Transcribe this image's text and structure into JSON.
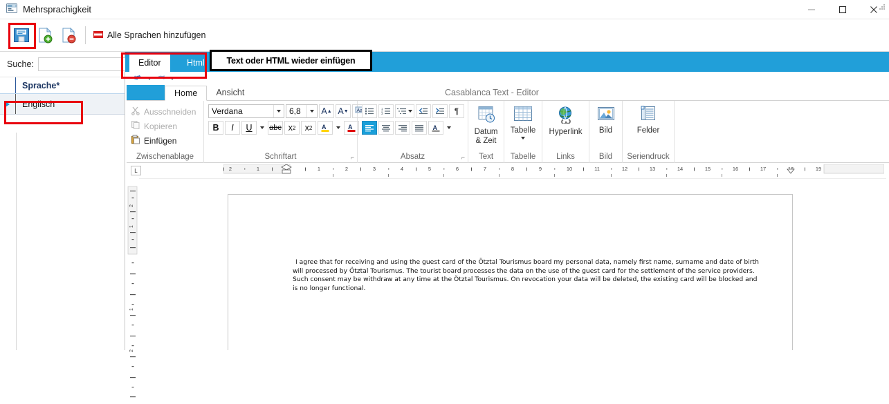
{
  "window": {
    "title": "Mehrsprachigkeit",
    "app_icon": "multilanguage-icon",
    "controls": {
      "minimize": "minimize-icon",
      "maximize": "maximize-icon",
      "close": "close-icon"
    }
  },
  "toolbar": {
    "save_label": "Speichern",
    "add_label": "Hinzufügen",
    "remove_label": "Entfernen",
    "add_all_languages_label": "Alle Sprachen hinzufügen"
  },
  "sidebar": {
    "search": {
      "label": "Suche:",
      "value": "",
      "placeholder": "",
      "clear_label": "×"
    },
    "grid": {
      "columns": [
        "Sprache*"
      ],
      "rows": [
        {
          "indicator": "▶",
          "language": "Englisch"
        }
      ]
    }
  },
  "callout": {
    "text": "Text oder HTML wieder einfügen"
  },
  "editor": {
    "tabs": [
      {
        "label": "Editor",
        "selected": true
      },
      {
        "label": "Html",
        "selected": false
      }
    ],
    "window_title": "Casablanca Text - Editor",
    "quick_access": [
      "undo-icon",
      "redo-icon",
      "customize-icon"
    ],
    "ribbon_tabs": [
      {
        "label": "Home",
        "selected": true
      },
      {
        "label": "Ansicht",
        "selected": false
      }
    ],
    "ribbon_groups": [
      {
        "name": "Zwischenablage",
        "items": [
          {
            "label": "Ausschneiden",
            "icon": "scissors-icon",
            "disabled": true
          },
          {
            "label": "Kopieren",
            "icon": "copy-icon",
            "disabled": true
          },
          {
            "label": "Einfügen",
            "icon": "paste-icon",
            "disabled": false
          }
        ]
      },
      {
        "name": "Schriftart",
        "font_family": "Verdana",
        "font_size": "6,8",
        "buttons": [
          "grow-font-icon",
          "shrink-font-icon",
          "change-case-icon",
          "bold-icon",
          "italic-icon",
          "underline-icon",
          "strikethrough-icon",
          "subscript-icon",
          "superscript-icon",
          "text-highlight-icon",
          "font-color-icon"
        ],
        "labels": {
          "bold": "B",
          "italic": "I",
          "underline": "U",
          "strike": "abc",
          "sub": "x₂",
          "sup": "x²",
          "A": "A"
        }
      },
      {
        "name": "Absatz",
        "buttons": [
          "bullets-icon",
          "numbering-icon",
          "multilevel-list-icon",
          "decrease-indent-icon",
          "increase-indent-icon",
          "show-marks-icon",
          "align-left-icon",
          "align-center-icon",
          "align-right-icon",
          "justify-icon",
          "shading-icon"
        ],
        "pilcrow": "¶"
      },
      {
        "name": "Text",
        "button": {
          "label": "Datum\n& Zeit",
          "line1": "Datum",
          "line2": "& Zeit",
          "icon": "date-time-icon"
        }
      },
      {
        "name": "Tabelle",
        "button": {
          "label": "Tabelle",
          "icon": "table-icon"
        }
      },
      {
        "name": "Links",
        "button": {
          "label": "Hyperlink",
          "icon": "hyperlink-icon"
        }
      },
      {
        "name": "Bild",
        "button": {
          "label": "Bild",
          "icon": "picture-icon"
        }
      },
      {
        "name": "Seriendruck",
        "button": {
          "label": "Felder",
          "icon": "fields-icon"
        }
      }
    ],
    "ruler": {
      "horizontal_left": [
        "2",
        "1"
      ],
      "horizontal_right": [
        "1",
        "2",
        "3",
        "4",
        "5",
        "6",
        "7",
        "8",
        "9",
        "10",
        "11",
        "12",
        "13",
        "14",
        "15",
        "16",
        "17",
        "18",
        "19"
      ],
      "vertical": [
        "2",
        "1",
        "1",
        "2"
      ],
      "tab_stop": "L"
    },
    "document": {
      "paragraph": "I agree that for receiving and using the guest card of the Ötztal Tourismus board my personal data, namely first name, surname and date of birth will processed by Ötztal Tourismus. The tourist board processes the data on the use of the guest card for the settlement of the service providers. Such consent may be withdraw at any time at the Ötztal Tourismus. On revocation your data will be deleted, the existing card will be blocked and is no longer functional."
    }
  },
  "colors": {
    "accent_blue": "#219fd9",
    "highlight_red": "#e8000d",
    "ribbon_text": "#444444"
  }
}
